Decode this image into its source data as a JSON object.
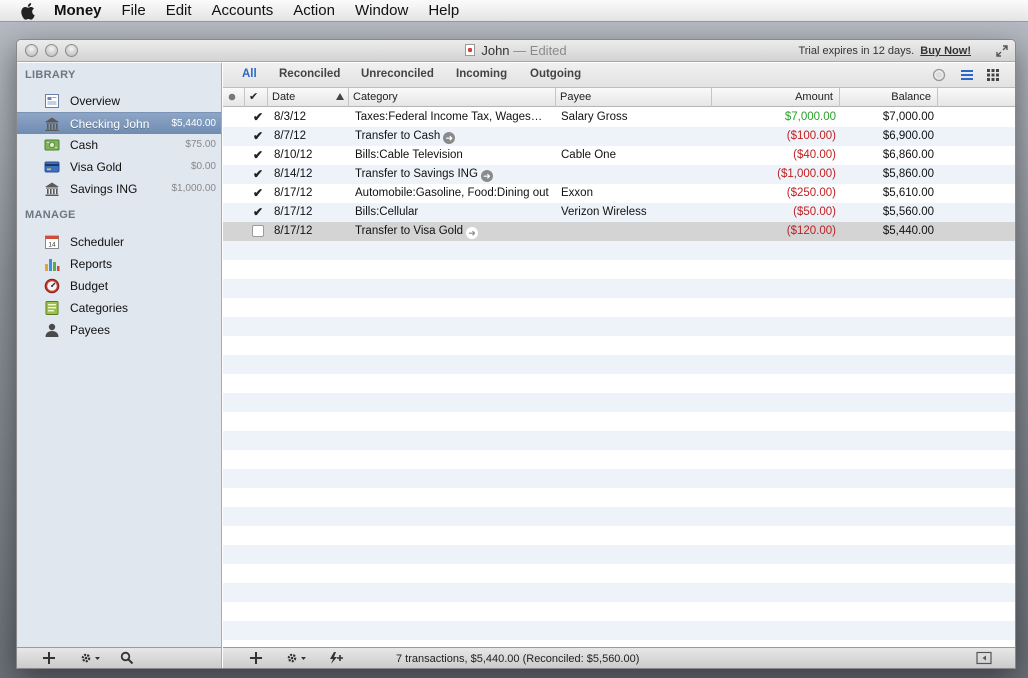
{
  "menubar": {
    "app": "Money",
    "items": [
      "File",
      "Edit",
      "Accounts",
      "Action",
      "Window",
      "Help"
    ]
  },
  "window": {
    "title": "John",
    "edited": "— Edited",
    "trial_text": "Trial expires in 12 days.",
    "buy_now": "Buy Now!"
  },
  "sidebar": {
    "library_heading": "LIBRARY",
    "manage_heading": "MANAGE",
    "library": [
      {
        "label": "Overview",
        "amount": "",
        "icon": "overview-icon"
      },
      {
        "label": "Checking John",
        "amount": "$5,440.00",
        "icon": "bank-icon"
      },
      {
        "label": "Cash",
        "amount": "$75.00",
        "icon": "cash-icon"
      },
      {
        "label": "Visa Gold",
        "amount": "$0.00",
        "icon": "credit-card-icon"
      },
      {
        "label": "Savings ING",
        "amount": "$1,000.00",
        "icon": "bank-icon"
      }
    ],
    "manage": [
      {
        "label": "Scheduler",
        "icon": "calendar-icon",
        "calendar_day": "14"
      },
      {
        "label": "Reports",
        "icon": "bar-chart-icon"
      },
      {
        "label": "Budget",
        "icon": "gauge-icon"
      },
      {
        "label": "Categories",
        "icon": "book-icon"
      },
      {
        "label": "Payees",
        "icon": "person-icon"
      }
    ]
  },
  "filters": {
    "tabs": [
      "All",
      "Reconciled",
      "Unreconciled",
      "Incoming",
      "Outgoing"
    ],
    "active": "All"
  },
  "columns": {
    "date": "Date",
    "category": "Category",
    "payee": "Payee",
    "amount": "Amount",
    "balance": "Balance"
  },
  "transactions": [
    {
      "checked": true,
      "date": "8/3/12",
      "category": "Taxes:Federal Income Tax, Wages…",
      "transfer": false,
      "payee": "Salary Gross",
      "amount": "$7,000.00",
      "amount_type": "pos",
      "balance": "$7,000.00"
    },
    {
      "checked": true,
      "date": "8/7/12",
      "category": "Transfer to Cash",
      "transfer": true,
      "payee": "",
      "amount": "($100.00)",
      "amount_type": "neg",
      "balance": "$6,900.00"
    },
    {
      "checked": true,
      "date": "8/10/12",
      "category": "Bills:Cable Television",
      "transfer": false,
      "payee": "Cable One",
      "amount": "($40.00)",
      "amount_type": "neg",
      "balance": "$6,860.00"
    },
    {
      "checked": true,
      "date": "8/14/12",
      "category": "Transfer to Savings ING",
      "transfer": true,
      "payee": "",
      "amount": "($1,000.00)",
      "amount_type": "neg",
      "balance": "$5,860.00"
    },
    {
      "checked": true,
      "date": "8/17/12",
      "category": "Automobile:Gasoline, Food:Dining out",
      "transfer": false,
      "payee": "Exxon",
      "amount": "($250.00)",
      "amount_type": "neg",
      "balance": "$5,610.00"
    },
    {
      "checked": true,
      "date": "8/17/12",
      "category": "Bills:Cellular",
      "transfer": false,
      "payee": "Verizon Wireless",
      "amount": "($50.00)",
      "amount_type": "neg",
      "balance": "$5,560.00"
    },
    {
      "checked": false,
      "date": "8/17/12",
      "category": "Transfer to Visa Gold",
      "transfer": true,
      "payee": "",
      "amount": "($120.00)",
      "amount_type": "neg",
      "balance": "$5,440.00",
      "selected": true
    }
  ],
  "colors": {
    "positive": "#2aa02a",
    "negative": "#c01f1f",
    "accent": "#2a67c9",
    "sidebar_selection": "#7a94b8"
  },
  "status": "7 transactions, $5,440.00 (Reconciled: $5,560.00)"
}
